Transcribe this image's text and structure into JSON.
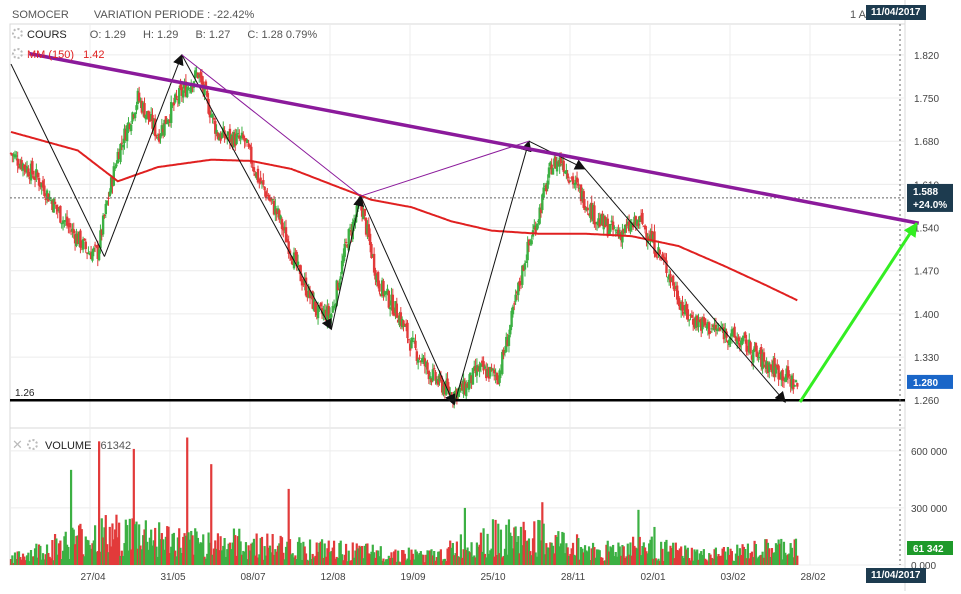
{
  "header": {
    "symbol": "SOMOCER",
    "variation_label": "VARIATION PERIODE : -22.42%",
    "right_label": "1 A",
    "date_top": "11/04/2017",
    "date_bottom": "11/04/2017"
  },
  "price_legend": {
    "series_label": "COURS",
    "open": "O: 1.29",
    "high": "H: 1.29",
    "low": "B: 1.27",
    "close": "C: 1.28 0.79%",
    "ma_label": "MM (150)",
    "ma_value": "1.42"
  },
  "volume_legend": {
    "label": "VOLUME",
    "value": "61342"
  },
  "colors": {
    "up": "#3cb043",
    "down": "#e23a3a",
    "ma": "#e02020",
    "trend": "#8b1a9b",
    "arrow": "#33ee22",
    "badge": "#1d3b4f",
    "badge_green": "#1e9a2a"
  },
  "chart_data": {
    "type": "candlestick",
    "x_tick_labels": [
      "27/04",
      "31/05",
      "08/07",
      "12/08",
      "19/09",
      "25/10",
      "28/11",
      "02/01",
      "03/02",
      "28/02"
    ],
    "price_axis": {
      "ticks": [
        "1.820",
        "1.750",
        "1.680",
        "1.610",
        "1.540",
        "1.470",
        "1.400",
        "1.330",
        "1.260"
      ],
      "range": [
        1.215,
        1.87
      ]
    },
    "volume_axis": {
      "ticks": [
        "600 000",
        "300 000",
        "0.000"
      ],
      "range": [
        0,
        720000
      ]
    },
    "support_level": {
      "value": 1.26,
      "label": "1.26"
    },
    "badges": {
      "projection": "1.588",
      "projection_pct": "+24.0%",
      "last_price": "1.280",
      "last_volume": "61 342"
    },
    "last_price": 1.28,
    "projection_price": 1.588,
    "price_path_anchors": [
      [
        0,
        1.66
      ],
      [
        20,
        1.62
      ],
      [
        40,
        1.55
      ],
      [
        58,
        1.5
      ],
      [
        65,
        1.5
      ],
      [
        72,
        1.58
      ],
      [
        80,
        1.66
      ],
      [
        95,
        1.75
      ],
      [
        110,
        1.69
      ],
      [
        125,
        1.75
      ],
      [
        140,
        1.79
      ],
      [
        155,
        1.69
      ],
      [
        175,
        1.68
      ],
      [
        185,
        1.62
      ],
      [
        200,
        1.56
      ],
      [
        215,
        1.47
      ],
      [
        230,
        1.4
      ],
      [
        240,
        1.4
      ],
      [
        252,
        1.52
      ],
      [
        262,
        1.58
      ],
      [
        275,
        1.45
      ],
      [
        290,
        1.4
      ],
      [
        300,
        1.35
      ],
      [
        315,
        1.3
      ],
      [
        330,
        1.27
      ],
      [
        340,
        1.28
      ],
      [
        350,
        1.31
      ],
      [
        365,
        1.3
      ],
      [
        372,
        1.36
      ],
      [
        385,
        1.49
      ],
      [
        395,
        1.56
      ],
      [
        405,
        1.64
      ],
      [
        412,
        1.65
      ],
      [
        425,
        1.6
      ],
      [
        440,
        1.55
      ],
      [
        455,
        1.53
      ],
      [
        472,
        1.55
      ],
      [
        480,
        1.52
      ],
      [
        492,
        1.47
      ],
      [
        505,
        1.4
      ],
      [
        520,
        1.38
      ],
      [
        535,
        1.37
      ],
      [
        550,
        1.35
      ],
      [
        565,
        1.32
      ],
      [
        580,
        1.3
      ],
      [
        590,
        1.28
      ]
    ],
    "ma_150": [
      [
        0,
        1.695
      ],
      [
        50,
        1.665
      ],
      [
        80,
        1.615
      ],
      [
        110,
        1.638
      ],
      [
        150,
        1.65
      ],
      [
        180,
        1.648
      ],
      [
        210,
        1.635
      ],
      [
        240,
        1.61
      ],
      [
        270,
        1.585
      ],
      [
        300,
        1.573
      ],
      [
        330,
        1.55
      ],
      [
        360,
        1.535
      ],
      [
        395,
        1.53
      ],
      [
        430,
        1.53
      ],
      [
        465,
        1.526
      ],
      [
        500,
        1.51
      ],
      [
        535,
        1.477
      ],
      [
        565,
        1.447
      ],
      [
        590,
        1.421
      ]
    ],
    "zigzag": [
      [
        0,
        1.805
      ],
      [
        70,
        1.493
      ],
      [
        128,
        1.82
      ],
      [
        240,
        1.375
      ],
      [
        262,
        1.591
      ],
      [
        332,
        1.253
      ],
      [
        388,
        1.68
      ],
      [
        430,
        1.635
      ],
      [
        580,
        1.257
      ]
    ],
    "trend_helper": [
      [
        128,
        1.82
      ],
      [
        262,
        1.591
      ],
      [
        388,
        1.68
      ]
    ],
    "resistance_line": [
      [
        -20,
        1.839
      ],
      [
        665,
        1.547
      ]
    ],
    "projection_arrow": [
      [
        585,
        1.257
      ],
      [
        665,
        1.547
      ]
    ],
    "volume_base": [
      [
        0,
        40000
      ],
      [
        60,
        190000
      ],
      [
        100,
        200000
      ],
      [
        130,
        140000
      ],
      [
        170,
        140000
      ],
      [
        230,
        100000
      ],
      [
        270,
        80000
      ],
      [
        320,
        60000
      ],
      [
        350,
        170000
      ],
      [
        390,
        180000
      ],
      [
        440,
        90000
      ],
      [
        470,
        120000
      ],
      [
        520,
        60000
      ],
      [
        580,
        110000
      ]
    ],
    "volume_spikes": [
      [
        45,
        500000
      ],
      [
        66,
        650000
      ],
      [
        92,
        610000
      ],
      [
        132,
        670000
      ],
      [
        150,
        530000
      ],
      [
        208,
        400000
      ],
      [
        340,
        300000
      ],
      [
        398,
        330000
      ],
      [
        470,
        290000
      ],
      [
        482,
        200000
      ]
    ]
  }
}
